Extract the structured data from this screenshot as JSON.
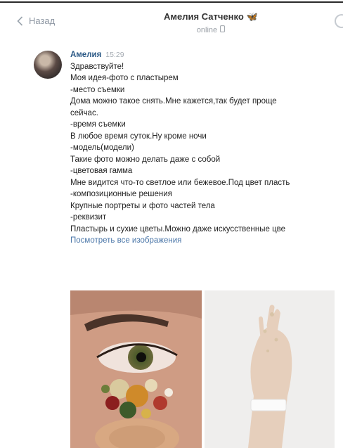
{
  "header": {
    "back_label": "Назад",
    "title": "Амелия Сатченко",
    "title_badge": "🦋",
    "status": "online"
  },
  "message": {
    "author": "Амелия",
    "time": "15:29",
    "lines": [
      "Здравствуйте!",
      "Моя идея-фото с пластырем",
      "-место съемки",
      "Дома можно такое снять.Мне кажется,так будет проще",
      "сейчас.",
      "-время съемки",
      "В любое время суток.Ну кроме ночи",
      "-модель(модели)",
      "Такие фото можно делать даже с собой",
      "-цветовая гамма",
      "Мне видится что-то светлое или бежевое.Под цвет пласть",
      "-композиционные решения",
      "Крупные портреты и фото частей тела",
      "-реквизит",
      "Пластырь и сухие цветы.Можно даже искусственные цве"
    ],
    "link": "Посмотреть все изображения"
  },
  "colors": {
    "link": "#4a76a8",
    "author": "#2a5885",
    "muted": "#8e97a3"
  }
}
